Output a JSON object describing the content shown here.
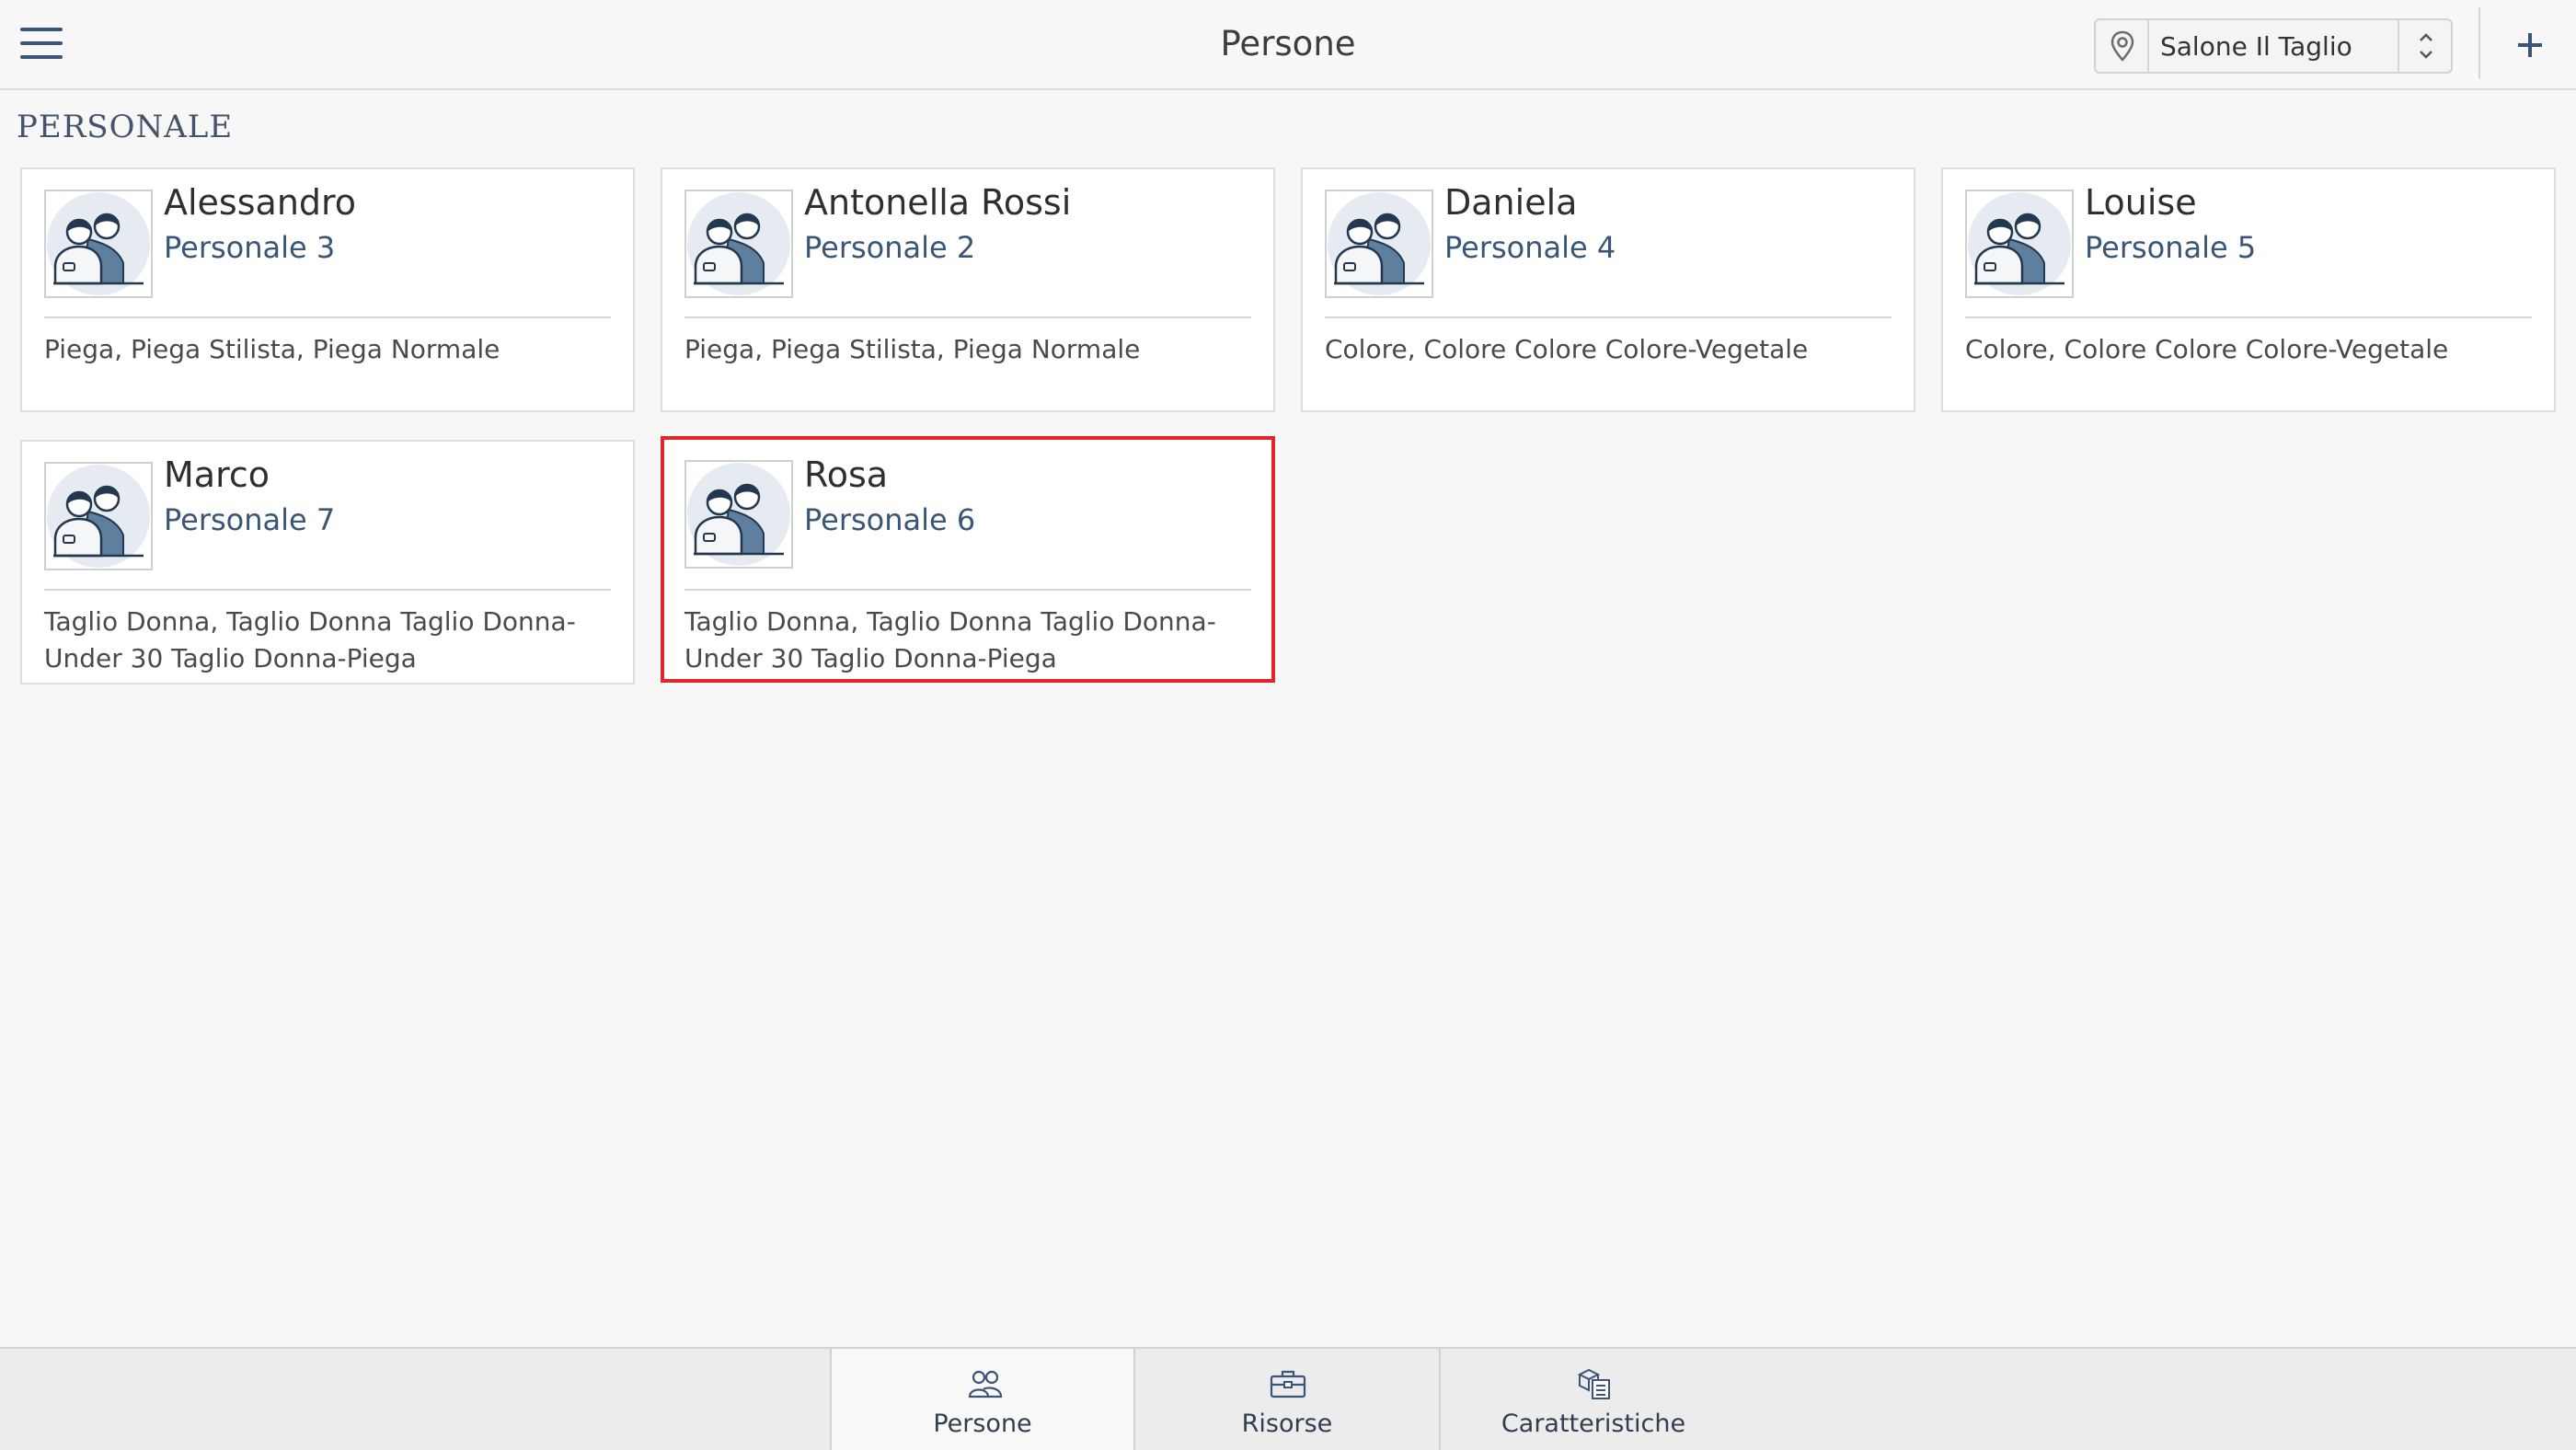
{
  "header": {
    "title": "Persone",
    "location_select": {
      "value": "Salone Il Taglio"
    }
  },
  "section": {
    "title": "PERSONALE"
  },
  "staff": [
    {
      "name": "Alessandro",
      "role": "Personale 3",
      "services": "Piega, Piega Stilista, Piega Normale"
    },
    {
      "name": "Antonella Rossi",
      "role": "Personale 2",
      "services": "Piega, Piega Stilista, Piega Normale"
    },
    {
      "name": "Daniela",
      "role": "Personale 4",
      "services": "Colore, Colore Colore Colore-Vegetale"
    },
    {
      "name": "Louise",
      "role": "Personale 5",
      "services": "Colore, Colore Colore Colore-Vegetale"
    },
    {
      "name": "Marco",
      "role": "Personale 7",
      "services": "Taglio Donna, Taglio Donna Taglio Donna-Under 30 Taglio Donna-Piega"
    },
    {
      "name": "Rosa",
      "role": "Personale 6",
      "services": "Taglio Donna, Taglio Donna Taglio Donna-Under 30 Taglio Donna-Piega",
      "selected": true
    }
  ],
  "tabs": [
    {
      "label": "Persone",
      "icon": "people-icon",
      "active": true
    },
    {
      "label": "Risorse",
      "icon": "toolbox-icon",
      "active": false
    },
    {
      "label": "Caratteristiche",
      "icon": "features-icon",
      "active": false
    }
  ],
  "colors": {
    "accent": "#3a5676",
    "selection": "#e3262d"
  }
}
